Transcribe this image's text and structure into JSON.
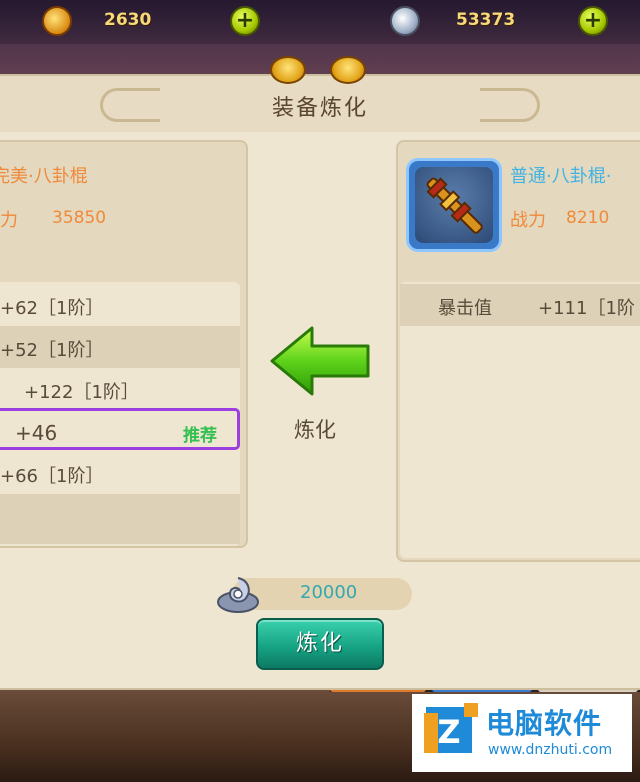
{
  "currency": {
    "gold": "2630",
    "silver": "53373",
    "plus_glyph": "+"
  },
  "panel": {
    "title": "装备炼化"
  },
  "left_equipment": {
    "name": "完美·八卦棍",
    "power_label": "战力",
    "power_value": "35850",
    "stats": [
      "+62［1阶］",
      "+52［1阶］",
      "+122［1阶］",
      "+46",
      "+66［1阶］"
    ],
    "recommended_tag": "推荐"
  },
  "center": {
    "action_label": "炼化",
    "arrow_icon": "green-left-arrow-icon"
  },
  "right_equipment": {
    "name": "普通·八卦棍·",
    "power_label": "战力",
    "power_value": "8210",
    "stat_name": "暴击值",
    "stat_value": "+111［1阶"
  },
  "cost": {
    "icon": "silver-coin-icon",
    "value": "20000"
  },
  "refine_button": {
    "label": "炼化"
  },
  "watermark": {
    "title": "电脑软件",
    "url": "www.dnzhuti.com",
    "logo_letter": "Z"
  },
  "colors": {
    "left_name": "#f08a3a",
    "right_name": "#3fb3e3",
    "recommended": "#33c050",
    "selection_border": "#9b3fe0",
    "button": "#17a485",
    "cost_text": "#33a8b0"
  }
}
